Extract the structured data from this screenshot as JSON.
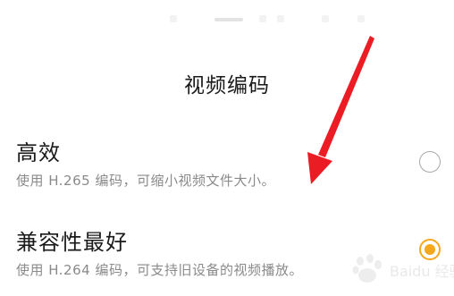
{
  "sheet": {
    "title": "视频编码"
  },
  "options": [
    {
      "title": "高效",
      "description": "使用 H.265 编码，可缩小视频文件大小。",
      "selected": false
    },
    {
      "title": "兼容性最好",
      "description": "使用 H.264 编码，可支持旧设备的视频播放。",
      "selected": true
    }
  ],
  "colors": {
    "accent": "#f5a81c",
    "arrow": "#ec1c24",
    "text_primary": "#1a1a1a",
    "text_secondary": "#8a8a8a"
  },
  "watermark": {
    "text": "Baidu 经验"
  }
}
